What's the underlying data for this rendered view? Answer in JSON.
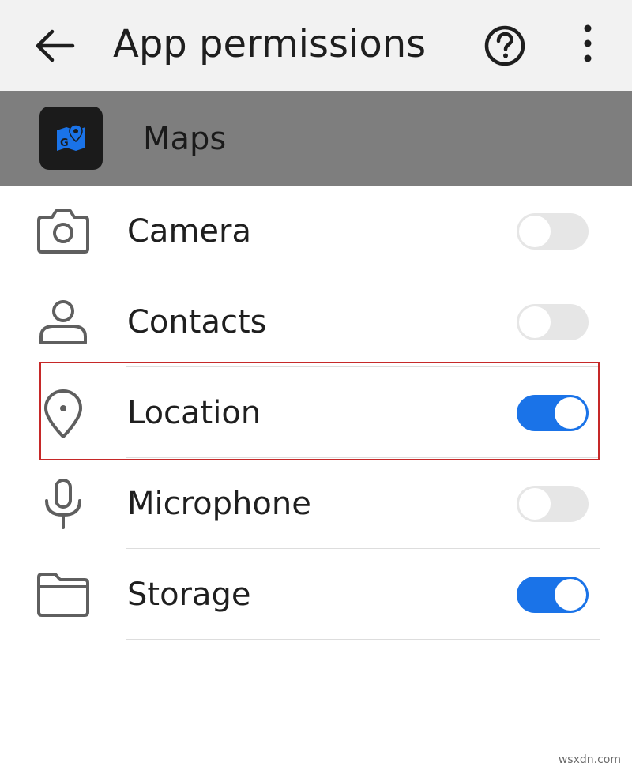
{
  "appbar": {
    "title": "App permissions",
    "back_icon": "arrow-left-icon",
    "help_icon": "help-circle-icon",
    "more_icon": "more-vertical-icon"
  },
  "app": {
    "name": "Maps",
    "icon": "google-maps-icon",
    "band_color": "#7e7e7e"
  },
  "permissions": [
    {
      "label": "Camera",
      "icon": "camera-icon",
      "enabled": false
    },
    {
      "label": "Contacts",
      "icon": "person-icon",
      "enabled": false
    },
    {
      "label": "Location",
      "icon": "location-pin-icon",
      "enabled": true,
      "highlighted": true
    },
    {
      "label": "Microphone",
      "icon": "microphone-icon",
      "enabled": false
    },
    {
      "label": "Storage",
      "icon": "folder-icon",
      "enabled": true
    }
  ],
  "colors": {
    "toggle_on": "#1a73e8",
    "toggle_off": "#e6e6e6",
    "highlight": "#c62828"
  },
  "watermark": "wsxdn.com"
}
